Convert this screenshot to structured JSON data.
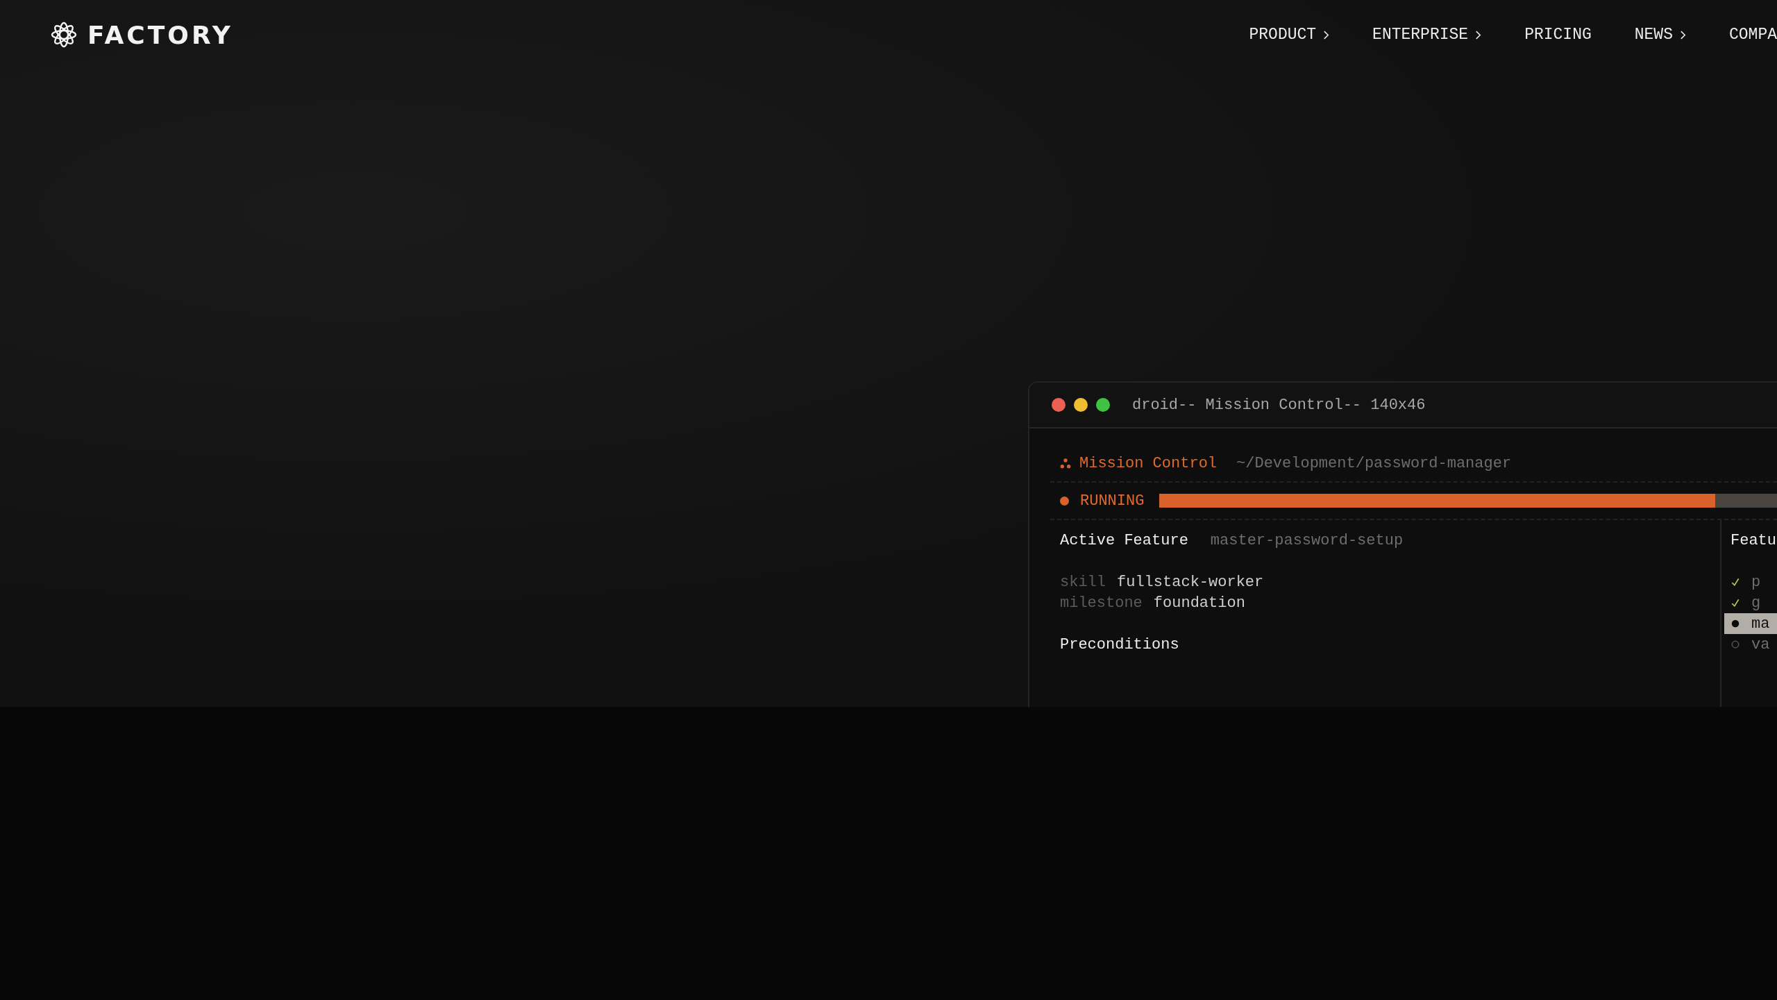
{
  "brand": {
    "name": "FACTORY"
  },
  "nav": [
    {
      "label": "PRODUCT",
      "has_menu": true
    },
    {
      "label": "ENTERPRISE",
      "has_menu": true
    },
    {
      "label": "PRICING",
      "has_menu": false
    },
    {
      "label": "NEWS",
      "has_menu": true
    },
    {
      "label": "COMPA",
      "has_menu": false
    }
  ],
  "terminal": {
    "title": "droid-- Mission Control-- 140x46",
    "app_name": "Mission Control",
    "path": "~/Development/password-manager",
    "status": "RUNNING",
    "progress": {
      "level": 0.9
    },
    "active_feature": {
      "label": "Active Feature",
      "name": "master-password-setup"
    },
    "details": [
      {
        "key": "skill",
        "value": "fullstack-worker"
      },
      {
        "key": "milestone",
        "value": "foundation"
      }
    ],
    "preconditions_heading": "Preconditions",
    "features_panel": {
      "heading": "Featu",
      "items": [
        {
          "kind": "done",
          "label": "p",
          "selected": false
        },
        {
          "kind": "done",
          "label": "g",
          "selected": false
        },
        {
          "kind": "active",
          "label": "ma",
          "selected": true
        },
        {
          "kind": "pending",
          "label": "va",
          "selected": false
        }
      ]
    }
  }
}
